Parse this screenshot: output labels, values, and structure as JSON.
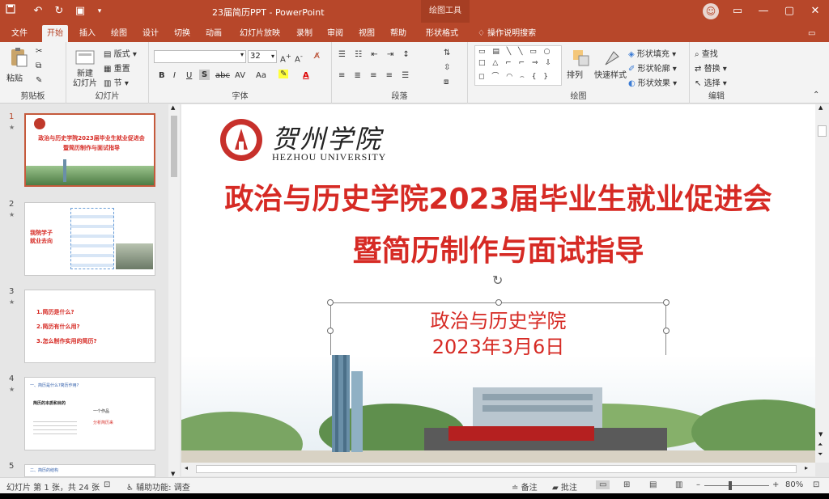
{
  "titlebar": {
    "doc_title": "23届简历PPT  -  PowerPoint",
    "context_tab": "绘图工具",
    "colors": {
      "bar": "#b7472a"
    }
  },
  "tabs": [
    "文件",
    "开始",
    "插入",
    "绘图",
    "设计",
    "切换",
    "动画",
    "幻灯片放映",
    "录制",
    "审阅",
    "视图",
    "帮助",
    "形状格式"
  ],
  "active_tab": "开始",
  "tell_me": "操作说明搜索",
  "ribbon": {
    "clipboard": {
      "label": "剪贴板",
      "paste": "粘贴"
    },
    "slides": {
      "label": "幻灯片",
      "new_slide": "新建\n幻灯片",
      "layout": "版式",
      "reset": "重置",
      "section": "节"
    },
    "font": {
      "label": "字体",
      "font_size": "32",
      "bold": "B",
      "italic": "I",
      "underline": "U",
      "shadow": "S",
      "strike": "abc",
      "spacing": "AV",
      "case": "Aa",
      "color": "A"
    },
    "paragraph": {
      "label": "段落"
    },
    "drawing": {
      "label": "绘图",
      "arrange": "排列",
      "quick_styles": "快速样式",
      "fill": "形状填充",
      "outline": "形状轮廓",
      "effects": "形状效果"
    },
    "editing": {
      "label": "编辑",
      "find": "查找",
      "replace": "替换",
      "select": "选择"
    }
  },
  "thumbnails": [
    {
      "num": "1",
      "title": "政治与历史学院2023届毕业生就业促进会",
      "subtitle": "暨简历制作与面试指导"
    },
    {
      "num": "2",
      "title": "我院学子\n就业去向"
    },
    {
      "num": "3",
      "lines": [
        "1.简历是什么?",
        "2.简历有什么用?",
        "3.怎么制作实用的简历?"
      ]
    },
    {
      "num": "4",
      "lines": [
        "一、简历是什么?简历作用?",
        "简历的本质和目的",
        "一个作品",
        "分析简历来"
      ]
    },
    {
      "num": "5",
      "lines": [
        "二、简历的结构"
      ]
    }
  ],
  "slide": {
    "logo_cn": "贺州学院",
    "logo_en": "HEZHOU UNIVERSITY",
    "title_line1": "政治与历史学院2023届毕业生就业促进会",
    "title_line2": "暨简历制作与面试指导",
    "sub_line1": "政治与历史学院",
    "sub_line2": "2023年3月6日",
    "accent": "#d62a24"
  },
  "status": {
    "slide_info": "幻灯片 第 1 张，共 24 张",
    "accessibility": "辅助功能: 调查",
    "notes": "备注",
    "comments": "批注",
    "zoom": "80%"
  }
}
